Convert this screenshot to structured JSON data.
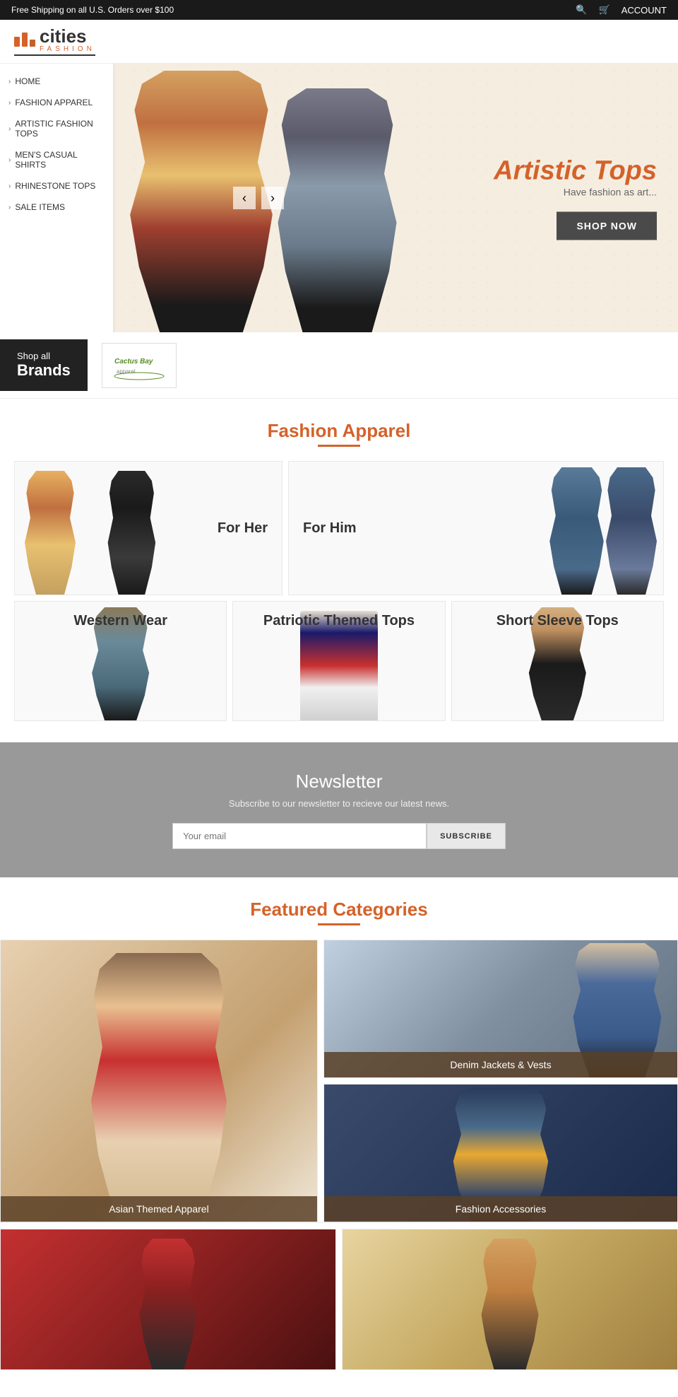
{
  "topbar": {
    "shipping_text": "Free Shipping on all U.S. Orders over $100",
    "account_label": "ACCOUNT"
  },
  "logo": {
    "cities": "cities",
    "fashion": "FASHION"
  },
  "nav": {
    "items": [
      {
        "label": "HOME"
      },
      {
        "label": "FASHION APPAREL"
      },
      {
        "label": "ARTISTIC FASHION TOPS"
      },
      {
        "label": "MEN'S CASUAL SHIRTS"
      },
      {
        "label": "RHINESTONE TOPS"
      },
      {
        "label": "SALE ITEMS"
      }
    ]
  },
  "hero": {
    "title": "Artistic Tops",
    "subtitle": "Have fashion as art...",
    "cta": "SHOP NOW"
  },
  "brands": {
    "shop_all": "Shop all",
    "brands_label": "Brands",
    "brand_name": "Cactus Bay"
  },
  "fashion_apparel": {
    "section_title": "Fashion Apparel",
    "for_her": "For Her",
    "for_him": "For Him",
    "western_wear": "Western Wear",
    "patriotic_tops": "Patriotic Themed Tops",
    "short_sleeve": "Short Sleeve Tops"
  },
  "newsletter": {
    "title": "Newsletter",
    "subtitle": "Subscribe to our newsletter to recieve our latest news.",
    "input_placeholder": "Your email",
    "button_label": "SUBSCRIBE"
  },
  "featured": {
    "section_title": "Featured Categories",
    "categories": [
      {
        "label": "Asian Themed Apparel"
      },
      {
        "label": "Denim Jackets & Vests"
      },
      {
        "label": "Fashion Accessories"
      }
    ]
  }
}
